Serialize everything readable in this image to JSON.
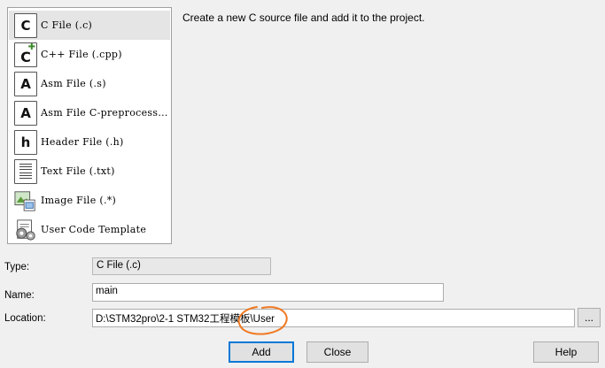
{
  "file_types": [
    {
      "label": "C File (.c)",
      "icon": "c-file-icon",
      "glyph": "C",
      "selected": true
    },
    {
      "label": "C++ File (.cpp)",
      "icon": "cpp-file-icon",
      "glyph": "C",
      "selected": false
    },
    {
      "label": "Asm File (.s)",
      "icon": "asm-file-icon",
      "glyph": "A",
      "selected": false
    },
    {
      "label": "Asm File C-preprocess...",
      "icon": "asm-preprocess-file-icon",
      "glyph": "A",
      "selected": false
    },
    {
      "label": "Header File (.h)",
      "icon": "header-file-icon",
      "glyph": "h",
      "selected": false
    },
    {
      "label": "Text File (.txt)",
      "icon": "text-file-icon",
      "glyph": "",
      "selected": false
    },
    {
      "label": "Image File (.*)",
      "icon": "image-file-icon",
      "glyph": "",
      "selected": false
    },
    {
      "label": "User Code Template",
      "icon": "user-template-icon",
      "glyph": "",
      "selected": false
    }
  ],
  "description": "Create a new C source file and add it to the project.",
  "form": {
    "type_label": "Type:",
    "type_value": "C File (.c)",
    "name_label": "Name:",
    "name_value": "main",
    "location_label": "Location:",
    "location_value": "D:\\STM32pro\\2-1 STM32工程模板\\User",
    "browse_label": "..."
  },
  "buttons": {
    "add": "Add",
    "close": "Close",
    "help": "Help"
  },
  "colors": {
    "annotation": "#f07820",
    "selected_bg": "#e5e5e5",
    "default_button_border": "#0078d7"
  }
}
